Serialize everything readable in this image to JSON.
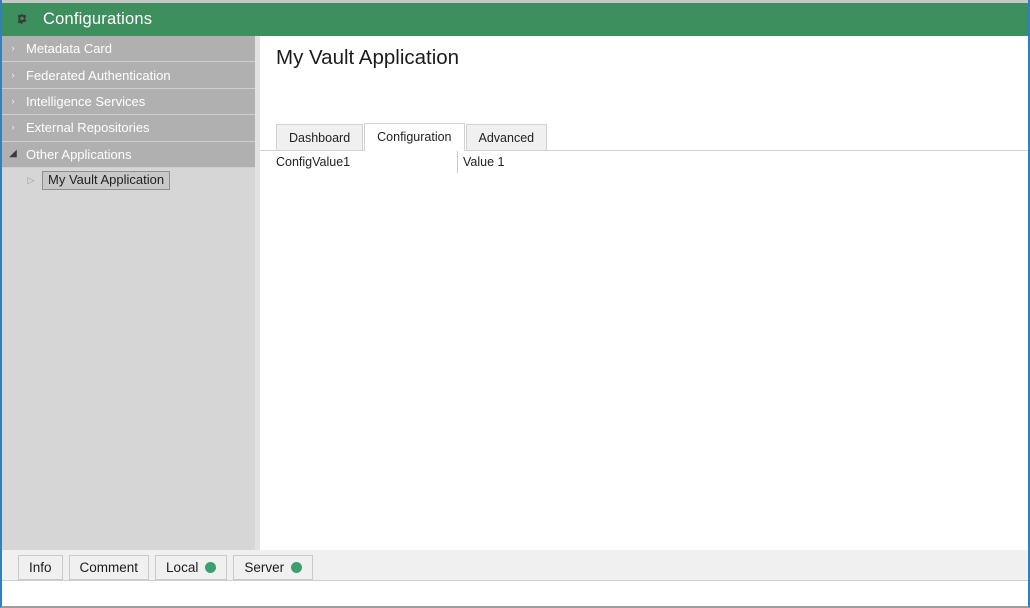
{
  "window": {
    "border_color": "#2f7fc4"
  },
  "header": {
    "icon": "gear-icon",
    "title": "Configurations",
    "background": "#3d8f5e",
    "text_color": "#ffffff"
  },
  "sidebar": {
    "items": [
      {
        "label": "Metadata Card",
        "expanded": false,
        "selected": false,
        "level": 0,
        "twisty": "›"
      },
      {
        "label": "Federated Authentication",
        "expanded": false,
        "selected": false,
        "level": 0,
        "twisty": "›"
      },
      {
        "label": "Intelligence Services",
        "expanded": false,
        "selected": false,
        "level": 0,
        "twisty": "›"
      },
      {
        "label": "External Repositories",
        "expanded": false,
        "selected": false,
        "level": 0,
        "twisty": "›"
      },
      {
        "label": "Other Applications",
        "expanded": true,
        "selected": false,
        "level": 0,
        "twisty": "◢"
      },
      {
        "label": "My Vault Application",
        "expanded": false,
        "selected": true,
        "level": 1,
        "twisty": "▷"
      }
    ]
  },
  "main": {
    "page_title": "My Vault Application",
    "tabs": [
      {
        "label": "Dashboard",
        "active": false
      },
      {
        "label": "Configuration",
        "active": true
      },
      {
        "label": "Advanced",
        "active": false
      }
    ],
    "content": {
      "key": "ConfigValue1",
      "value": "Value 1"
    }
  },
  "bottom_bar": {
    "tabs": [
      {
        "label": "Info",
        "dot": null
      },
      {
        "label": "Comment",
        "dot": null
      },
      {
        "label": "Local",
        "dot": "#3c9f6e"
      },
      {
        "label": "Server",
        "dot": "#3c9f6e"
      }
    ]
  }
}
